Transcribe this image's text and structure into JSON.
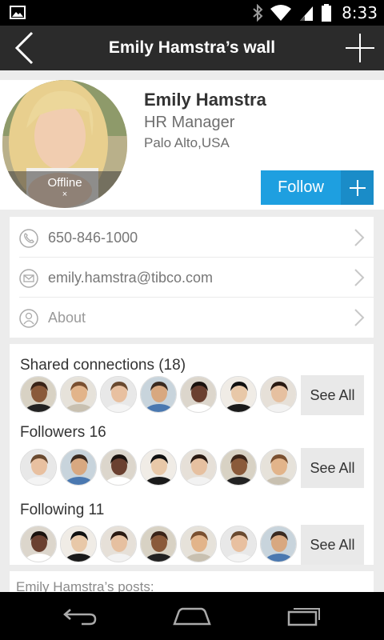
{
  "status_bar": {
    "time": "8:33",
    "icons": [
      "image-icon",
      "bluetooth-icon",
      "wifi-icon",
      "signal-icon",
      "battery-icon"
    ]
  },
  "action_bar": {
    "title": "Emily Hamstra’s wall",
    "icons": [
      "back-icon",
      "add-icon"
    ]
  },
  "profile": {
    "name": "Emily Hamstra",
    "role": "HR Manager",
    "location": "Palo Alto,USA",
    "presence": "Offline",
    "presence_mark": "×",
    "follow_label": "Follow"
  },
  "contacts": [
    {
      "icon": "phone-icon",
      "text": "650-846-1000"
    },
    {
      "icon": "email-icon",
      "text": "emily.hamstra@tibco.com"
    },
    {
      "icon": "person-icon",
      "text": "About"
    }
  ],
  "sections": {
    "shared": {
      "title": "Shared connections (18)",
      "see_all": "See All"
    },
    "followers": {
      "title": "Followers 16",
      "see_all": "See All"
    },
    "following": {
      "title": "Following 11",
      "see_all": "See All"
    }
  },
  "posts": {
    "title": "Emily Hamstra’s posts:"
  },
  "nav": [
    "back-nav-icon",
    "home-nav-icon",
    "recents-nav-icon"
  ],
  "colors": {
    "accent": "#1e9fe0",
    "accent_dark": "#1a8cc8",
    "action_bar": "#2b2b2b",
    "background": "#ececec"
  }
}
